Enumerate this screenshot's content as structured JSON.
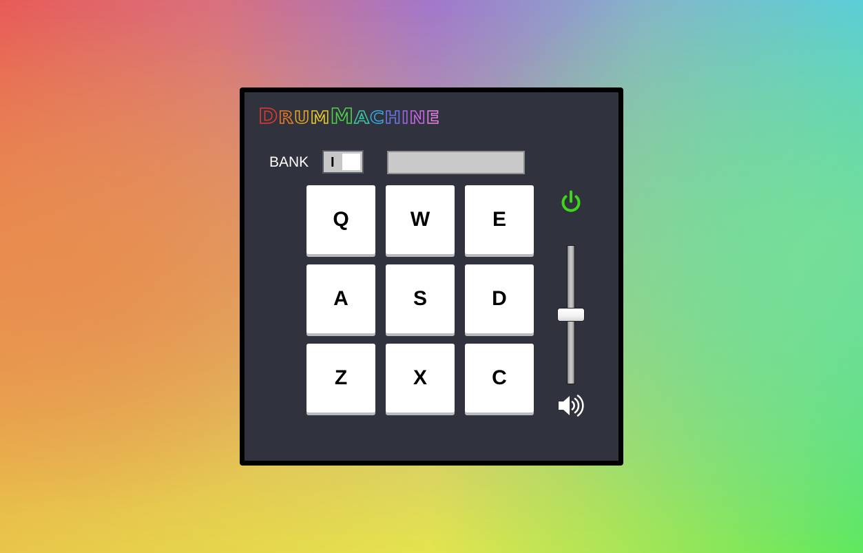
{
  "app": {
    "title_letters": [
      {
        "ch": "D",
        "color": "#e63a2e",
        "size": "big"
      },
      {
        "ch": "R",
        "color": "#e8782a",
        "size": "small"
      },
      {
        "ch": "U",
        "color": "#e8a628",
        "size": "small"
      },
      {
        "ch": "M",
        "color": "#e8c830",
        "size": "small"
      },
      {
        "ch": "M",
        "color": "#4fd24a",
        "size": "big"
      },
      {
        "ch": "A",
        "color": "#3cc8a8",
        "size": "small"
      },
      {
        "ch": "C",
        "color": "#3aa8e0",
        "size": "small"
      },
      {
        "ch": "H",
        "color": "#6a78e6",
        "size": "small"
      },
      {
        "ch": "I",
        "color": "#a066e6",
        "size": "small"
      },
      {
        "ch": "N",
        "color": "#c866e6",
        "size": "small"
      },
      {
        "ch": "E",
        "color": "#e880e8",
        "size": "small"
      }
    ]
  },
  "bank": {
    "label": "BANK",
    "toggle_value": "I"
  },
  "display": {
    "text": ""
  },
  "pads": [
    {
      "key": "Q"
    },
    {
      "key": "W"
    },
    {
      "key": "E"
    },
    {
      "key": "A"
    },
    {
      "key": "S"
    },
    {
      "key": "D"
    },
    {
      "key": "Z"
    },
    {
      "key": "X"
    },
    {
      "key": "C"
    }
  ],
  "power": {
    "icon": "power-icon",
    "on": true,
    "color": "#3fd51c"
  },
  "volume": {
    "icon": "volume-icon",
    "level_fraction": 0.5
  },
  "colors": {
    "panel": "#30333d",
    "border": "#000000",
    "pad": "#ffffff"
  }
}
